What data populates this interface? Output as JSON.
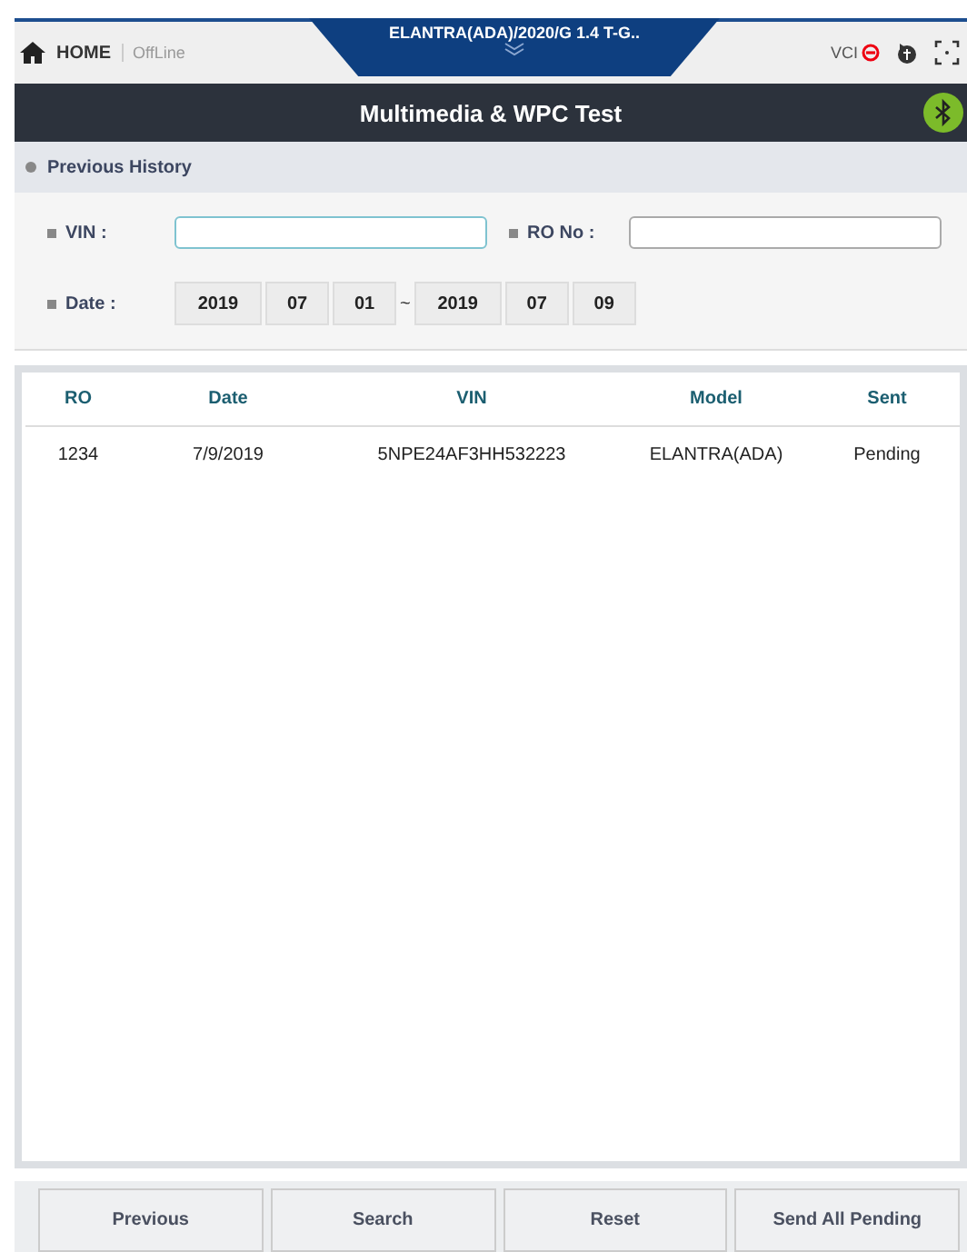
{
  "topbar": {
    "home": "HOME",
    "status": "OffLine",
    "vehicle": "ELANTRA(ADA)/2020/G 1.4 T-G..",
    "vci": "VCI"
  },
  "title": "Multimedia & WPC Test",
  "section": "Previous History",
  "form": {
    "vin_label": "VIN :",
    "ro_label": "RO No :",
    "date_label": "Date :",
    "from": [
      "2019",
      "07",
      "01"
    ],
    "separator": "~",
    "to": [
      "2019",
      "07",
      "09"
    ]
  },
  "table": {
    "columns": [
      "RO",
      "Date",
      "VIN",
      "Model",
      "Sent"
    ],
    "rows": [
      [
        "1234",
        "7/9/2019",
        "5NPE24AF3HH532223",
        "ELANTRA(ADA)",
        "Pending"
      ]
    ]
  },
  "buttons": [
    "Previous",
    "Search",
    "Reset",
    "Send All Pending"
  ]
}
